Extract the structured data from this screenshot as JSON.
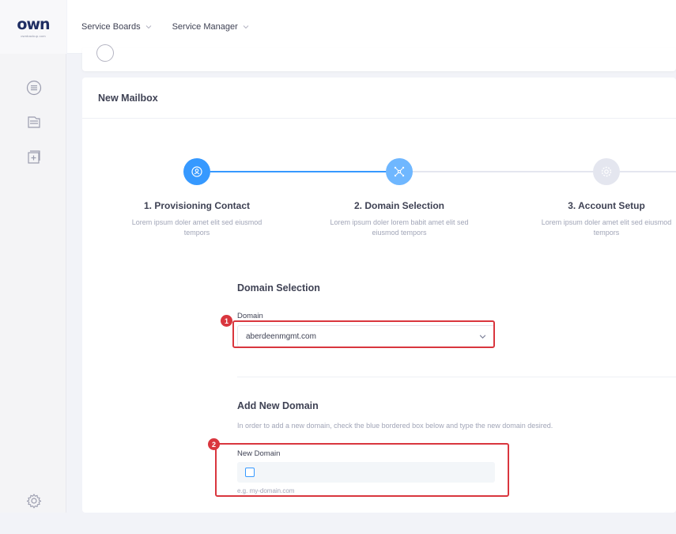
{
  "brand": {
    "logo_text": "own",
    "logo_sub": "ownbackup.com"
  },
  "icons": {
    "sidebar": [
      "list-icon",
      "folder-icon",
      "add-board-icon"
    ],
    "settings": "gear-icon"
  },
  "topnav": {
    "items": [
      {
        "label": "Service Boards"
      },
      {
        "label": "Service Manager"
      }
    ]
  },
  "card": {
    "title": "New Mailbox"
  },
  "stepper": {
    "steps": [
      {
        "title": "1. Provisioning Contact",
        "desc": "Lorem ipsum doler amet elit sed eiusmod tempors",
        "state": "active"
      },
      {
        "title": "2. Domain Selection",
        "desc": "Lorem ipsum doler lorem babit amet elit sed eiusmod tempors",
        "state": "current"
      },
      {
        "title": "3. Account Setup",
        "desc": "Lorem ipsum doler amet elit sed eiusmod tempors",
        "state": "pending"
      }
    ],
    "colors": {
      "active": "#3699ff",
      "current": "#6fb7ff",
      "pending": "#e4e6ef"
    }
  },
  "domain_selection": {
    "title": "Domain Selection",
    "domain_label": "Domain",
    "domain_value": "aberdeenmgmt.com",
    "annotation_number": "1"
  },
  "add_domain": {
    "title": "Add New Domain",
    "help_text": "In order to add a new domain, check the blue bordered box below and type the new domain desired.",
    "new_domain_label": "New Domain",
    "placeholder": "e.g. my-domain.com",
    "annotation_number": "2"
  },
  "colors": {
    "highlight": "#d9363e",
    "accent": "#3699ff"
  }
}
